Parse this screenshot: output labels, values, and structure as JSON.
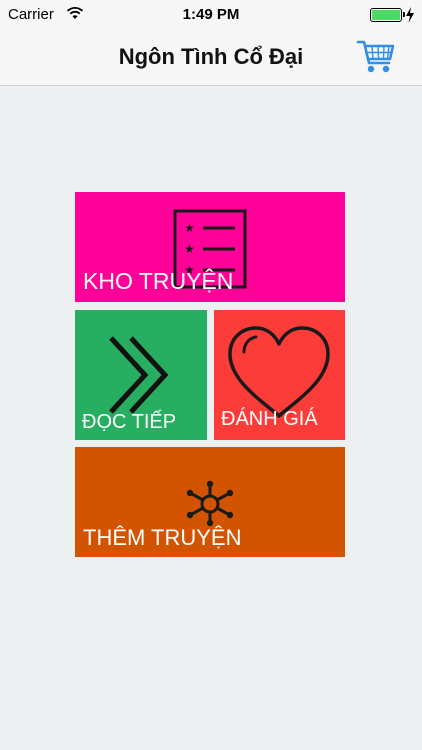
{
  "status_bar": {
    "carrier": "Carrier",
    "time": "1:49 PM"
  },
  "nav": {
    "title": "Ngôn Tình Cổ Đại",
    "cart_icon": "cart-icon"
  },
  "tiles": {
    "kho_truyen": {
      "label": "KHO TRUYỆN",
      "icon": "list-icon",
      "color": "#ff0099"
    },
    "doc_tiep": {
      "label": "ĐỌC TIẾP",
      "icon": "double-chevron-icon",
      "color": "#27ae60"
    },
    "danh_gia": {
      "label": "ĐÁNH GIÁ",
      "icon": "heart-icon",
      "color": "#fb3c38"
    },
    "them_truyen": {
      "label": "THÊM TRUYỆN",
      "icon": "network-icon",
      "color": "#d35400"
    }
  },
  "colors": {
    "background": "#ecf0f1",
    "cart_blue": "#2f8fe8",
    "battery_green": "#4cd964"
  }
}
